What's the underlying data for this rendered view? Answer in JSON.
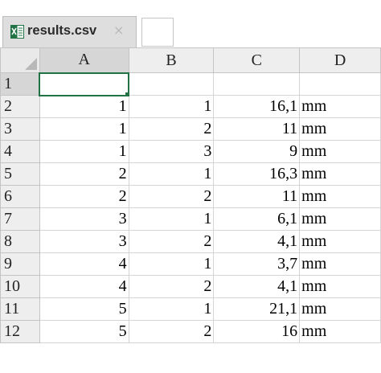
{
  "tab": {
    "icon": "excel-file-icon",
    "filename": "results.csv",
    "close_glyph": "×"
  },
  "sheet": {
    "columns": [
      "A",
      "B",
      "C",
      "D"
    ],
    "active_cell": "A1",
    "rows": [
      {
        "row": "1",
        "cells": [
          "",
          "",
          "",
          ""
        ]
      },
      {
        "row": "2",
        "cells": [
          "1",
          "1",
          "16,1",
          "mm"
        ]
      },
      {
        "row": "3",
        "cells": [
          "1",
          "2",
          "11",
          "mm"
        ]
      },
      {
        "row": "4",
        "cells": [
          "1",
          "3",
          "9",
          "mm"
        ]
      },
      {
        "row": "5",
        "cells": [
          "2",
          "1",
          "16,3",
          "mm"
        ]
      },
      {
        "row": "6",
        "cells": [
          "2",
          "2",
          "11",
          "mm"
        ]
      },
      {
        "row": "7",
        "cells": [
          "3",
          "1",
          "6,1",
          "mm"
        ]
      },
      {
        "row": "8",
        "cells": [
          "3",
          "2",
          "4,1",
          "mm"
        ]
      },
      {
        "row": "9",
        "cells": [
          "4",
          "1",
          "3,7",
          "mm"
        ]
      },
      {
        "row": "10",
        "cells": [
          "4",
          "2",
          "4,1",
          "mm"
        ]
      },
      {
        "row": "11",
        "cells": [
          "5",
          "1",
          "21,1",
          "mm"
        ]
      },
      {
        "row": "12",
        "cells": [
          "5",
          "2",
          "16",
          "mm"
        ]
      }
    ]
  },
  "colors": {
    "accent": "#217346",
    "header_bg": "#eeeeee",
    "selected_header_bg": "#d6d6d6",
    "grid": "#d4d4d4",
    "tab_bg": "#dedede"
  }
}
